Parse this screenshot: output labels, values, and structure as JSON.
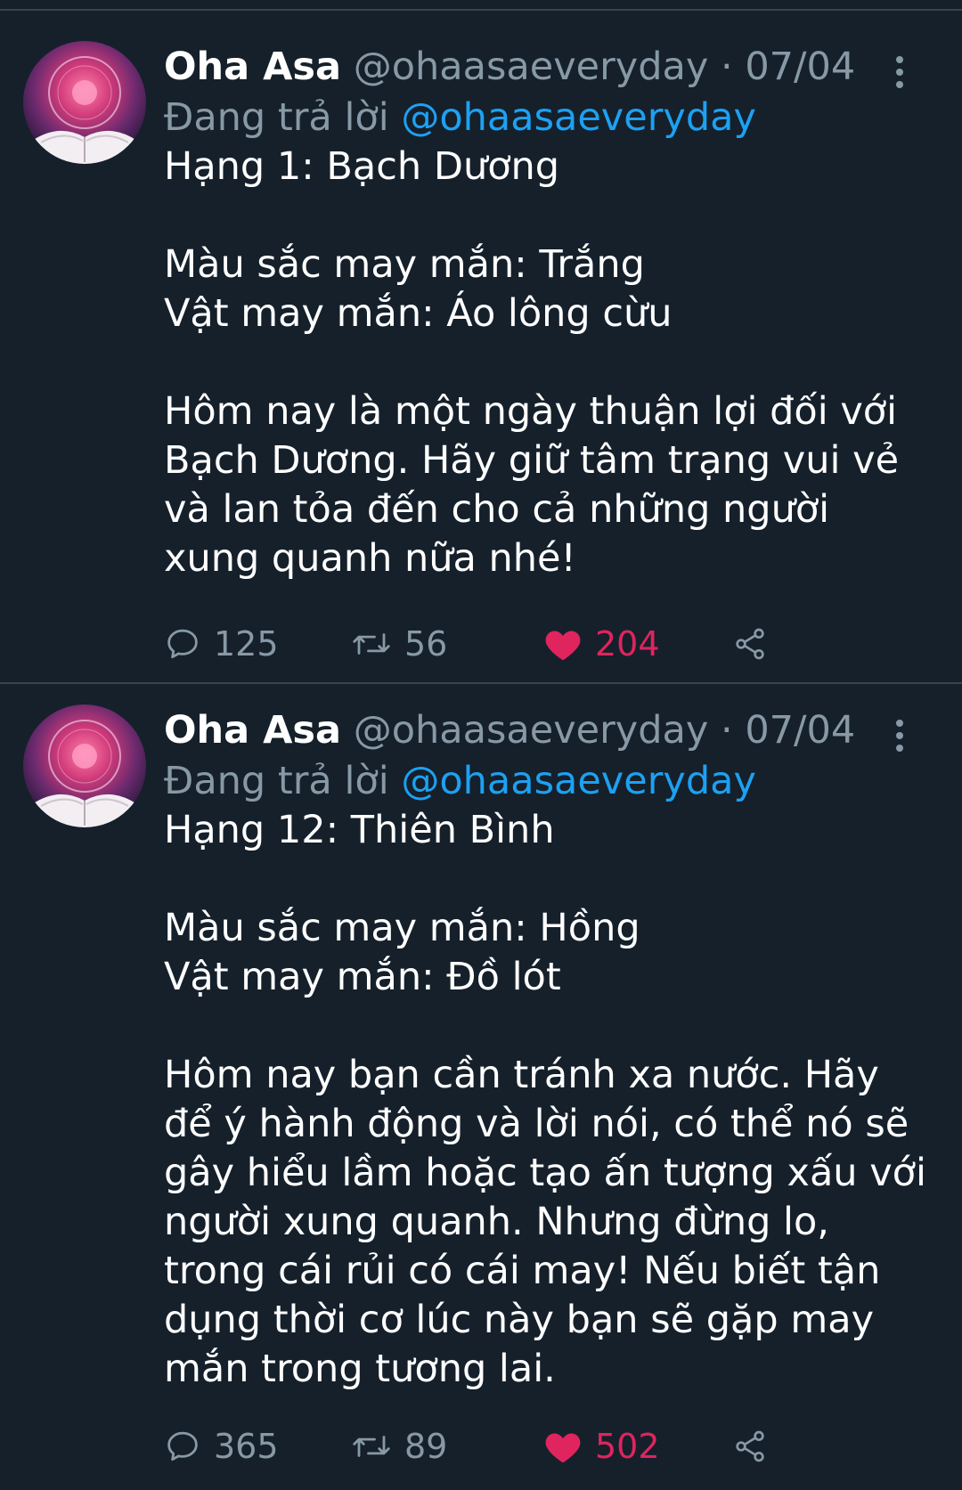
{
  "colors": {
    "background": "#15202b",
    "divider": "#38444d",
    "secondary_text": "#8899a6",
    "link": "#1da1f2",
    "like": "#e0245e"
  },
  "tweets": [
    {
      "author_name": "Oha Asa",
      "handle": "@ohaasaeveryday",
      "separator": "·",
      "date": "07/04",
      "replying_label": "Đang trả lời",
      "replying_to": "@ohaasaeveryday",
      "body": "Hạng 1: Bạch Dương\n\nMàu sắc may mắn: Trắng\nVật may mắn: Áo lông cừu\n\nHôm nay là một ngày thuận lợi đối với Bạch Dương. Hãy giữ tâm trạng vui vẻ và lan tỏa đến cho cả những người xung quanh nữa nhé!",
      "reply_count": "125",
      "retweet_count": "56",
      "like_count": "204",
      "liked": true
    },
    {
      "author_name": "Oha Asa",
      "handle": "@ohaasaeveryday",
      "separator": "·",
      "date": "07/04",
      "replying_label": "Đang trả lời",
      "replying_to": "@ohaasaeveryday",
      "body": "Hạng 12: Thiên Bình\n\nMàu sắc may mắn: Hồng\nVật may mắn: Đồ lót\n\nHôm nay bạn cần tránh xa nước. Hãy để ý hành động và lời nói, có thể nó sẽ gây hiểu lầm hoặc tạo ấn tượng xấu với người xung quanh. Nhưng đừng lo, trong cái rủi có cái may! Nếu biết tận dụng thời cơ lúc này bạn sẽ gặp may mắn trong tương lai.",
      "reply_count": "365",
      "retweet_count": "89",
      "like_count": "502",
      "liked": true
    }
  ],
  "icons": {
    "avatar": "zodiac-book-avatar",
    "more": "more-vertical-icon",
    "reply": "reply-bubble-icon",
    "retweet": "retweet-icon",
    "like": "heart-icon",
    "share": "share-icon"
  }
}
